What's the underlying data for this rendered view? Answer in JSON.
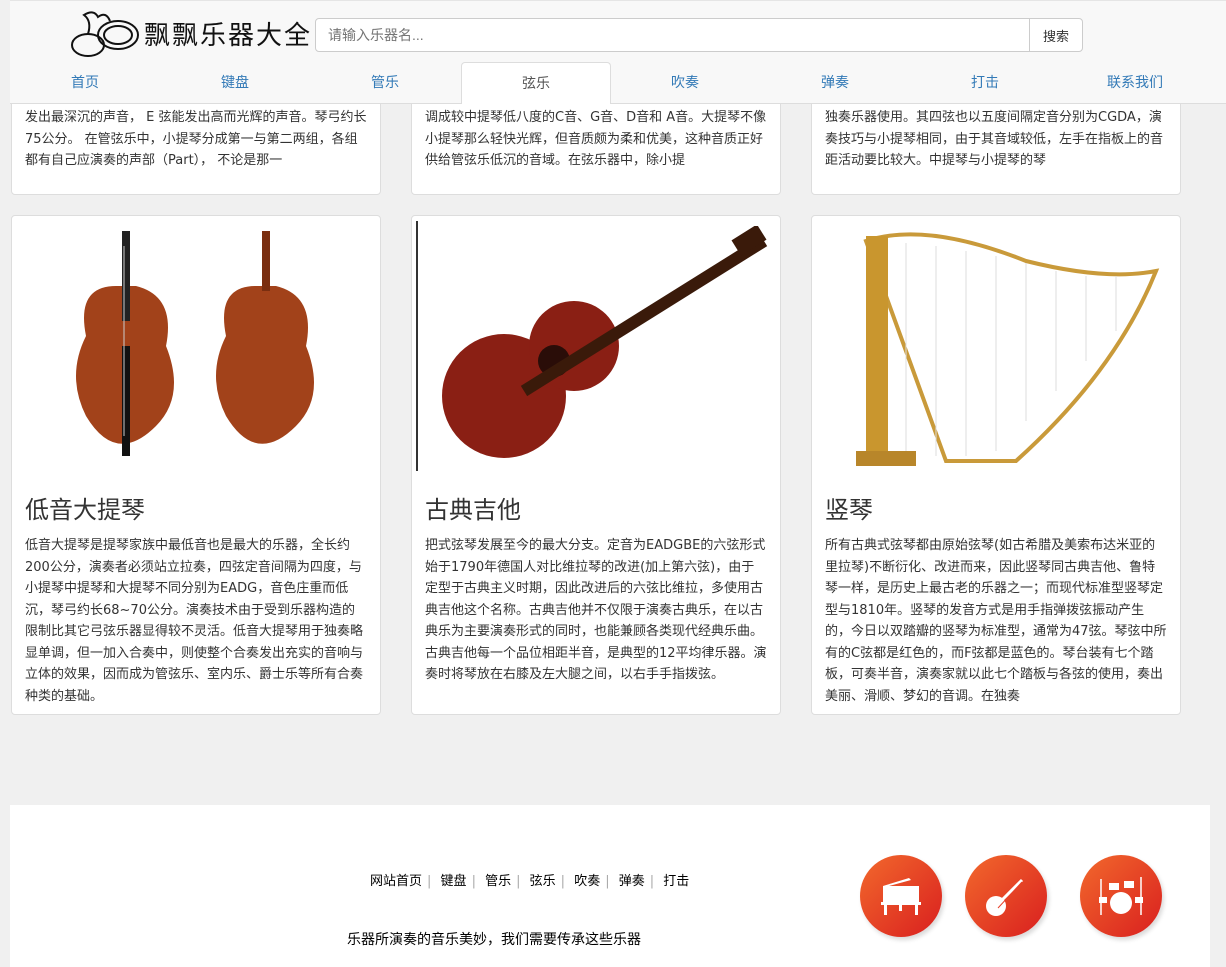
{
  "header": {
    "logo_text": "飘飘乐器大全",
    "search_placeholder": "请输入乐器名...",
    "search_button": "搜索"
  },
  "nav": {
    "tabs": [
      {
        "label": "首页"
      },
      {
        "label": "键盘"
      },
      {
        "label": "管乐"
      },
      {
        "label": "弦乐",
        "active": true
      },
      {
        "label": "吹奏"
      },
      {
        "label": "弹奏"
      },
      {
        "label": "打击"
      },
      {
        "label": "联系我们"
      }
    ]
  },
  "top_cards": [
    {
      "text": "发出最深沉的声音， E 弦能发出高而光辉的声音。琴弓约长75公分。 在管弦乐中，小提琴分成第一与第二两组，各组都有自己应演奏的声部（Part）， 不论是那一"
    },
    {
      "text": "调成较中提琴低八度的C音、G音、D音和 A音。大提琴不像小提琴那么轻快光辉，但音质颇为柔和优美，这种音质正好供给管弦乐低沉的音域。在弦乐器中，除小提"
    },
    {
      "text": "独奏乐器使用。其四弦也以五度间隔定音分别为CGDA，演奏技巧与小提琴相同，由于其音域较低，左手在指板上的音距活动要比较大。中提琴与小提琴的琴"
    }
  ],
  "cards": [
    {
      "title": "低音大提琴",
      "image": "double-bass",
      "text": "低音大提琴是提琴家族中最低音也是最大的乐器，全长约200公分，演奏者必须站立拉奏，四弦定音间隔为四度，与小提琴中提琴和大提琴不同分别为EADG，音色庄重而低沉，琴弓约长68~70公分。演奏技术由于受到乐器构造的限制比其它弓弦乐器显得较不灵活。低音大提琴用于独奏略显单调，但一加入合奏中，则使整个合奏发出充实的音响与立体的效果，因而成为管弦乐、室内乐、爵士乐等所有合奏种类的基础。"
    },
    {
      "title": "古典吉他",
      "image": "classical-guitar",
      "text": "把式弦琴发展至今的最大分支。定音为EADGBE的六弦形式始于1790年德国人对比维拉琴的改进(加上第六弦)，由于定型于古典主义时期，因此改进后的六弦比维拉，多使用古典吉他这个名称。古典吉他并不仅限于演奏古典乐，在以古典乐为主要演奏形式的同时，也能兼顾各类现代经典乐曲。古典吉他每一个品位相距半音，是典型的12平均律乐器。演奏时将琴放在右膝及左大腿之间，以右手手指拨弦。"
    },
    {
      "title": "竖琴",
      "image": "harp",
      "text": "所有古典式弦琴都由原始弦琴(如古希腊及美索布达米亚的里拉琴)不断衍化、改进而来，因此竖琴同古典吉他、鲁特琴一样，是历史上最古老的乐器之一；而现代标准型竖琴定型与1810年。竖琴的发音方式是用手指弹拨弦振动产生的，今日以双踏瓣的竖琴为标准型，通常为47弦。琴弦中所有的C弦都是红色的，而F弦都是蓝色的。琴台装有七个踏板，可奏半音，演奏家就以此七个踏板与各弦的使用，奏出美丽、滑顺、梦幻的音调。在独奏"
    }
  ],
  "footer": {
    "links": [
      "网站首页",
      "键盘",
      "管乐",
      "弦乐",
      "吹奏",
      "弹奏",
      "打击"
    ],
    "slogan": "乐器所演奏的音乐美妙，我们需要传承这些乐器",
    "icons": [
      "piano-icon",
      "banjo-icon",
      "drum-kit-icon"
    ]
  },
  "colors": {
    "link": "#337ab7",
    "footer_icon": "#e8402a"
  }
}
